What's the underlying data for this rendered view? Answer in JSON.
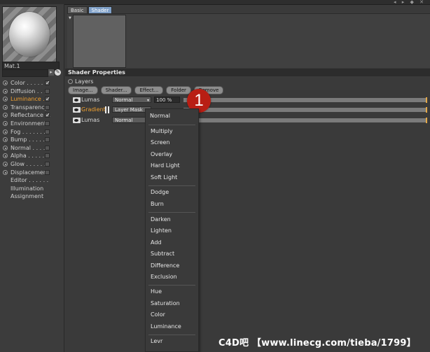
{
  "material": {
    "name": "Mat.1",
    "channels": [
      {
        "label": "Color . . . . . .",
        "checked": true
      },
      {
        "label": "Diffusion . . . .",
        "checked": false
      },
      {
        "label": "Luminance . .",
        "checked": true,
        "active": true
      },
      {
        "label": "Transparency",
        "checked": false
      },
      {
        "label": "Reflectance . .",
        "checked": true
      },
      {
        "label": "Environment",
        "checked": false
      },
      {
        "label": "Fog . . . . . . .",
        "checked": false
      },
      {
        "label": "Bump . . . . . .",
        "checked": false
      },
      {
        "label": "Normal . . . . .",
        "checked": false
      },
      {
        "label": "Alpha . . . . . .",
        "checked": false
      },
      {
        "label": "Glow . . . . . .",
        "checked": false
      },
      {
        "label": "Displacement",
        "checked": false
      }
    ],
    "extra": [
      "Editor . . . . . .",
      "Illumination",
      "Assignment"
    ]
  },
  "tabs": [
    {
      "label": "Basic",
      "active": false
    },
    {
      "label": "Shader",
      "active": true
    }
  ],
  "shader_properties": {
    "header": "Shader Properties",
    "layers_label": "Layers",
    "buttons": [
      "Image...",
      "Shader...",
      "Effect...",
      "Folder",
      "Remove"
    ],
    "rows": [
      {
        "name": "Lumas",
        "mode": "Normal",
        "percent": "100 %"
      },
      {
        "name": "Gradient",
        "mode": "Layer Mask",
        "percent": ""
      },
      {
        "name": "Lumas",
        "mode": "Normal",
        "percent": ""
      }
    ]
  },
  "step_badge": "1",
  "blend_menu": {
    "groups": [
      [
        "Normal"
      ],
      [
        "Multiply",
        "Screen",
        "Overlay",
        "Hard Light",
        "Soft Light"
      ],
      [
        "Dodge",
        "Burn"
      ],
      [
        "Darken",
        "Lighten",
        "Add",
        "Subtract",
        "Difference",
        "Exclusion"
      ],
      [
        "Hue",
        "Saturation",
        "Color",
        "Luminance"
      ],
      [
        "Levr"
      ]
    ]
  },
  "watermark": "C4D吧 【www.linecg.com/tieba/1799】",
  "colors": {
    "accent": "#f0a030",
    "tab_active": "#7fa0c8",
    "badge": "#b81e14"
  }
}
